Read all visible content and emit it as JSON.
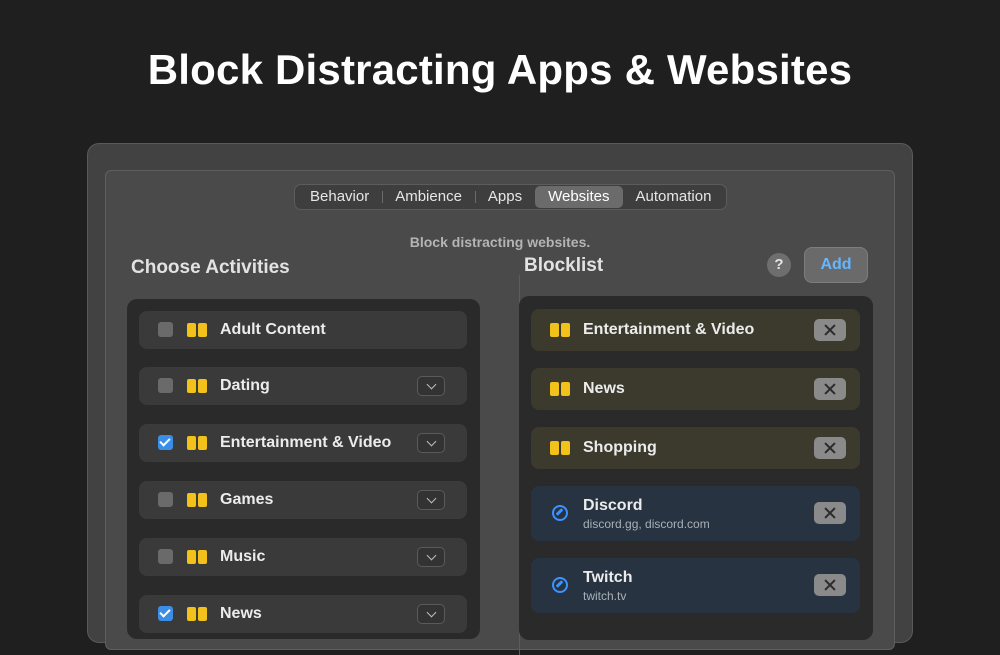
{
  "hero": {
    "title": "Block Distracting Apps & Websites"
  },
  "tabs": [
    {
      "label": "Behavior",
      "active": false
    },
    {
      "label": "Ambience",
      "active": false
    },
    {
      "label": "Apps",
      "active": false
    },
    {
      "label": "Websites",
      "active": true
    },
    {
      "label": "Automation",
      "active": false
    }
  ],
  "subtitle": "Block distracting websites.",
  "activities": {
    "title": "Choose Activities",
    "items": [
      {
        "label": "Adult Content",
        "checked": false,
        "expandable": false
      },
      {
        "label": "Dating",
        "checked": false,
        "expandable": true
      },
      {
        "label": "Entertainment & Video",
        "checked": true,
        "expandable": true
      },
      {
        "label": "Games",
        "checked": false,
        "expandable": true
      },
      {
        "label": "Music",
        "checked": false,
        "expandable": true
      },
      {
        "label": "News",
        "checked": true,
        "expandable": true
      }
    ]
  },
  "blocklist": {
    "title": "Blocklist",
    "help_label": "?",
    "add_label": "Add",
    "items": [
      {
        "type": "category",
        "label": "Entertainment & Video",
        "icon": "category-icon"
      },
      {
        "type": "category",
        "label": "News",
        "icon": "category-icon"
      },
      {
        "type": "category",
        "label": "Shopping",
        "icon": "category-icon"
      },
      {
        "type": "site",
        "label": "Discord",
        "domains": "discord.gg, discord.com",
        "icon": "compass-icon"
      },
      {
        "type": "site",
        "label": "Twitch",
        "domains": "twitch.tv",
        "icon": "compass-icon"
      }
    ]
  },
  "colors": {
    "accent_blue": "#3a8ee6",
    "category_yellow": "#f2c21b",
    "add_blue": "#66b6ff"
  }
}
